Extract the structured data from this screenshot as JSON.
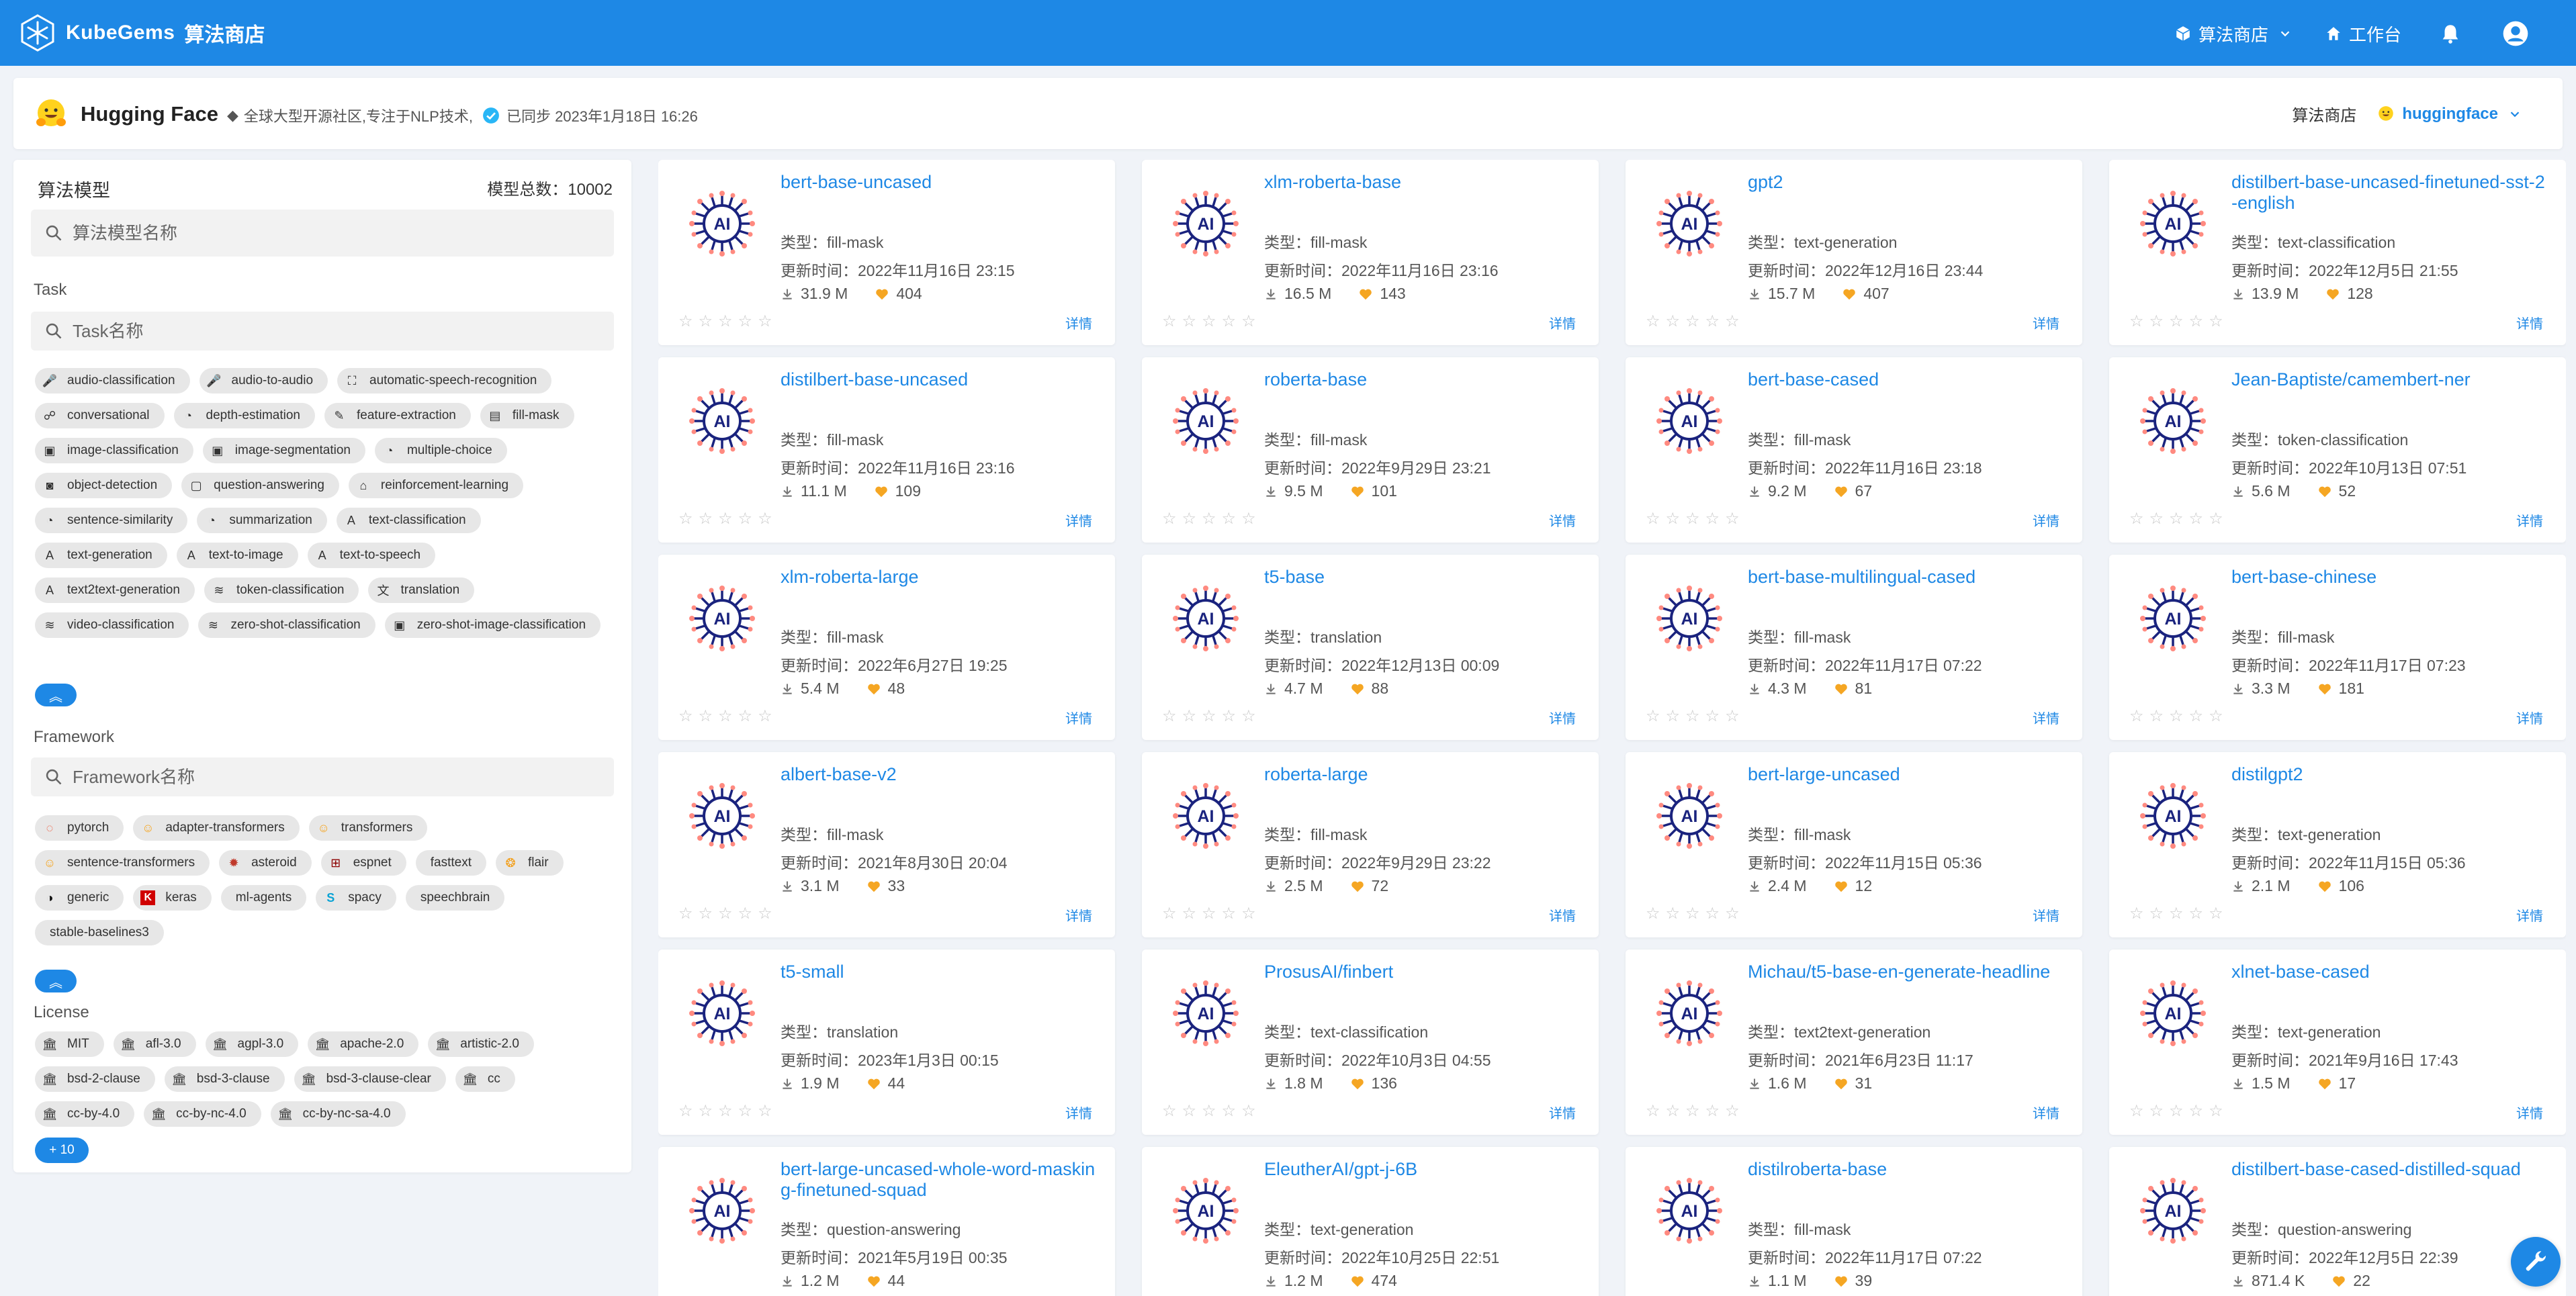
{
  "topbar": {
    "brand": "KubeGems",
    "brand_sub": "算法商店",
    "nav": [
      {
        "label": "算法商店",
        "icon": "cube-icon"
      },
      {
        "label": "工作台",
        "icon": "home-icon"
      }
    ]
  },
  "header": {
    "name": "Hugging Face",
    "desc": "全球大型开源社区,专注于NLP技术,",
    "sync": "已同步 2023年1月18日 16:26",
    "store": "算法商店",
    "user": "huggingface"
  },
  "panel": {
    "title": "算法模型",
    "total": "模型总数：10002",
    "search_placeholder": "算法模型名称",
    "task_label": "Task",
    "task_placeholder": "Task名称",
    "tasks": [
      "audio-classification",
      "audio-to-audio",
      "automatic-speech-recognition",
      "conversational",
      "depth-estimation",
      "feature-extraction",
      "fill-mask",
      "image-classification",
      "image-segmentation",
      "multiple-choice",
      "object-detection",
      "question-answering",
      "reinforcement-learning",
      "sentence-similarity",
      "summarization",
      "text-classification",
      "text-generation",
      "text-to-image",
      "text-to-speech",
      "text2text-generation",
      "token-classification",
      "translation",
      "video-classification",
      "zero-shot-classification",
      "zero-shot-image-classification"
    ],
    "framework_label": "Framework",
    "framework_placeholder": "Framework名称",
    "frameworks": [
      "pytorch",
      "adapter-transformers",
      "transformers",
      "sentence-transformers",
      "asteroid",
      "espnet",
      "fasttext",
      "flair",
      "generic",
      "keras",
      "ml-agents",
      "spacy",
      "speechbrain",
      "stable-baselines3"
    ],
    "license_label": "License",
    "licenses": [
      "MIT",
      "afl-3.0",
      "agpl-3.0",
      "apache-2.0",
      "artistic-2.0",
      "bsd-2-clause",
      "bsd-3-clause",
      "bsd-3-clause-clear",
      "cc",
      "cc-by-4.0",
      "cc-by-nc-4.0",
      "cc-by-nc-sa-4.0"
    ],
    "more": "+ 10"
  },
  "labels": {
    "type_prefix": "类型：",
    "time_prefix": "更新时间：",
    "detail": "详情"
  },
  "models": [
    {
      "name": "bert-base-uncased",
      "type": "fill-mask",
      "time": "2022年11月16日 23:15",
      "downloads": "31.9 M",
      "likes": "404"
    },
    {
      "name": "xlm-roberta-base",
      "type": "fill-mask",
      "time": "2022年11月16日 23:16",
      "downloads": "16.5 M",
      "likes": "143"
    },
    {
      "name": "gpt2",
      "type": "text-generation",
      "time": "2022年12月16日 23:44",
      "downloads": "15.7 M",
      "likes": "407"
    },
    {
      "name": "distilbert-base-uncased-finetuned-sst-2-english",
      "type": "text-classification",
      "time": "2022年12月5日 21:55",
      "downloads": "13.9 M",
      "likes": "128"
    },
    {
      "name": "distilbert-base-uncased",
      "type": "fill-mask",
      "time": "2022年11月16日 23:16",
      "downloads": "11.1 M",
      "likes": "109"
    },
    {
      "name": "roberta-base",
      "type": "fill-mask",
      "time": "2022年9月29日 23:21",
      "downloads": "9.5 M",
      "likes": "101"
    },
    {
      "name": "bert-base-cased",
      "type": "fill-mask",
      "time": "2022年11月16日 23:18",
      "downloads": "9.2 M",
      "likes": "67"
    },
    {
      "name": "Jean-Baptiste/camembert-ner",
      "type": "token-classification",
      "time": "2022年10月13日 07:51",
      "downloads": "5.6 M",
      "likes": "52"
    },
    {
      "name": "xlm-roberta-large",
      "type": "fill-mask",
      "time": "2022年6月27日 19:25",
      "downloads": "5.4 M",
      "likes": "48"
    },
    {
      "name": "t5-base",
      "type": "translation",
      "time": "2022年12月13日 00:09",
      "downloads": "4.7 M",
      "likes": "88"
    },
    {
      "name": "bert-base-multilingual-cased",
      "type": "fill-mask",
      "time": "2022年11月17日 07:22",
      "downloads": "4.3 M",
      "likes": "81"
    },
    {
      "name": "bert-base-chinese",
      "type": "fill-mask",
      "time": "2022年11月17日 07:23",
      "downloads": "3.3 M",
      "likes": "181"
    },
    {
      "name": "albert-base-v2",
      "type": "fill-mask",
      "time": "2021年8月30日 20:04",
      "downloads": "3.1 M",
      "likes": "33"
    },
    {
      "name": "roberta-large",
      "type": "fill-mask",
      "time": "2022年9月29日 23:22",
      "downloads": "2.5 M",
      "likes": "72"
    },
    {
      "name": "bert-large-uncased",
      "type": "fill-mask",
      "time": "2022年11月15日 05:36",
      "downloads": "2.4 M",
      "likes": "12"
    },
    {
      "name": "distilgpt2",
      "type": "text-generation",
      "time": "2022年11月15日 05:36",
      "downloads": "2.1 M",
      "likes": "106"
    },
    {
      "name": "t5-small",
      "type": "translation",
      "time": "2023年1月3日 00:15",
      "downloads": "1.9 M",
      "likes": "44"
    },
    {
      "name": "ProsusAI/finbert",
      "type": "text-classification",
      "time": "2022年10月3日 04:55",
      "downloads": "1.8 M",
      "likes": "136"
    },
    {
      "name": "Michau/t5-base-en-generate-headline",
      "type": "text2text-generation",
      "time": "2021年6月23日 11:17",
      "downloads": "1.6 M",
      "likes": "31"
    },
    {
      "name": "xlnet-base-cased",
      "type": "text-generation",
      "time": "2021年9月16日 17:43",
      "downloads": "1.5 M",
      "likes": "17"
    },
    {
      "name": "bert-large-uncased-whole-word-masking-finetuned-squad",
      "type": "question-answering",
      "time": "2021年5月19日 00:35",
      "downloads": "1.2 M",
      "likes": "44"
    },
    {
      "name": "EleutherAI/gpt-j-6B",
      "type": "text-generation",
      "time": "2022年10月25日 22:51",
      "downloads": "1.2 M",
      "likes": "474"
    },
    {
      "name": "distilroberta-base",
      "type": "fill-mask",
      "time": "2022年11月17日 07:22",
      "downloads": "1.1 M",
      "likes": "39"
    },
    {
      "name": "distilbert-base-cased-distilled-squad",
      "type": "question-answering",
      "time": "2022年12月5日 22:39",
      "downloads": "871.4 K",
      "likes": "22"
    }
  ],
  "colors": {
    "primary": "#1e88e5",
    "like": "#f5a623",
    "bg": "#f0f3f8"
  }
}
